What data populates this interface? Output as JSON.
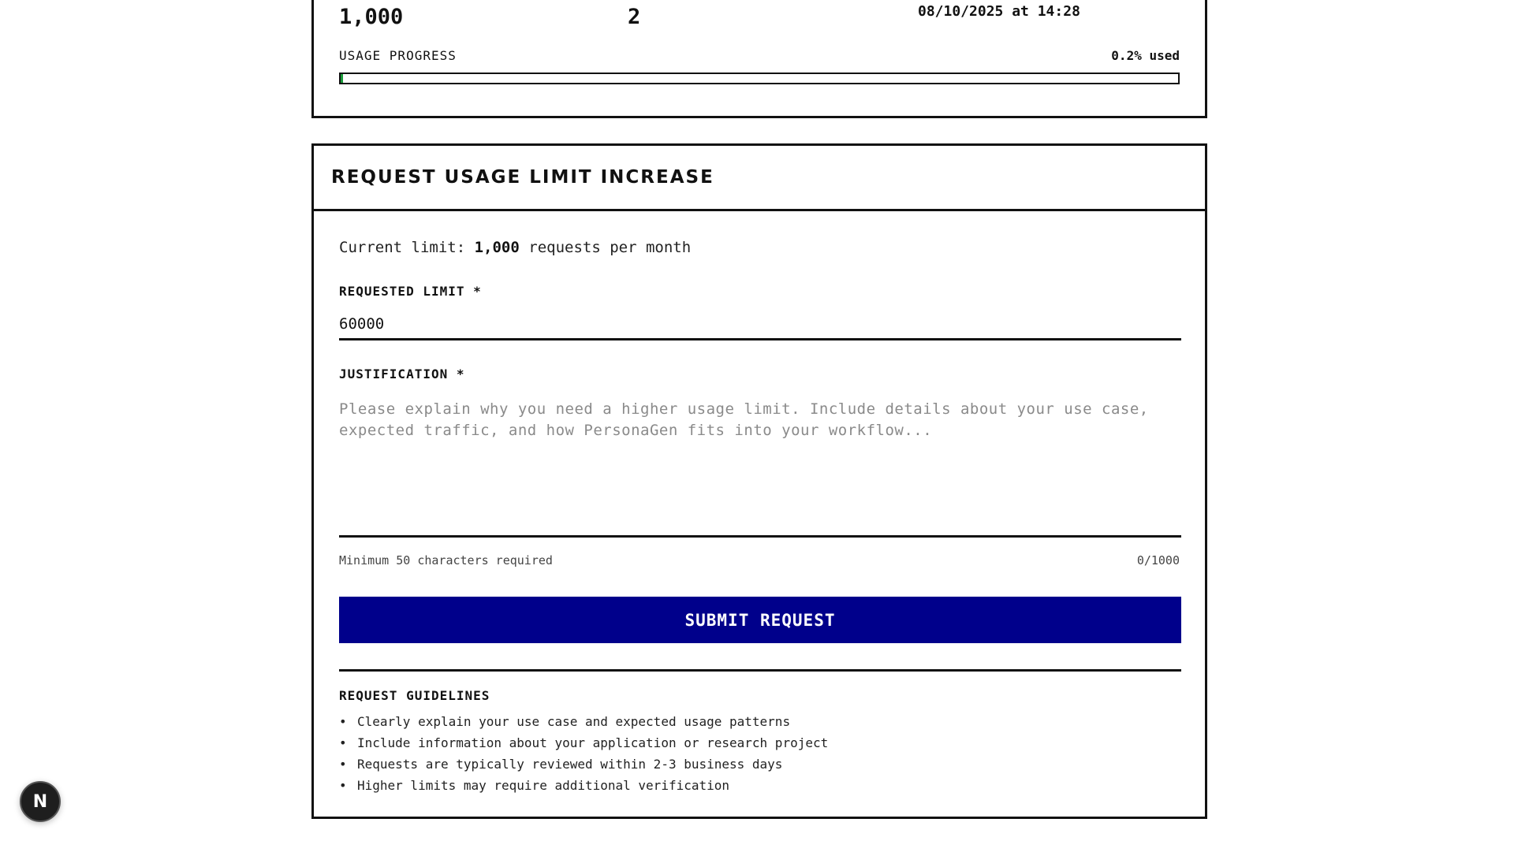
{
  "stats": {
    "monthly_limit": "1,000",
    "active_keys": "2",
    "last_used": "08/10/2025 at 14:28",
    "progress_label": "USAGE PROGRESS",
    "progress_percent_text": "0.2% used",
    "progress_fraction": 0.002
  },
  "request_form": {
    "title": "REQUEST USAGE LIMIT INCREASE",
    "current_limit_prefix": "Current limit:",
    "current_limit_value": "1,000",
    "current_limit_suffix": "requests per month",
    "requested_limit_label": "REQUESTED LIMIT *",
    "requested_limit_value": "60000",
    "justification_label": "JUSTIFICATION *",
    "justification_placeholder": "Please explain why you need a higher usage limit. Include details about your use case, expected traffic, and how PersonaGen fits into your workflow...",
    "justification_value": "",
    "min_chars_hint": "Minimum 50 characters required",
    "char_count": "0/1000",
    "submit_label": "SUBMIT REQUEST"
  },
  "guidelines": {
    "title": "REQUEST GUIDELINES",
    "items": [
      "Clearly explain your use case and expected usage patterns",
      "Include information about your application or research project",
      "Requests are typically reviewed within 2-3 business days",
      "Higher limits may require additional verification"
    ]
  },
  "badge": {
    "letter": "N",
    "icon": "nextjs-logo-icon"
  },
  "colors": {
    "accent": "#00008b",
    "progress_fill": "#1a9a3a",
    "border": "#111111"
  }
}
